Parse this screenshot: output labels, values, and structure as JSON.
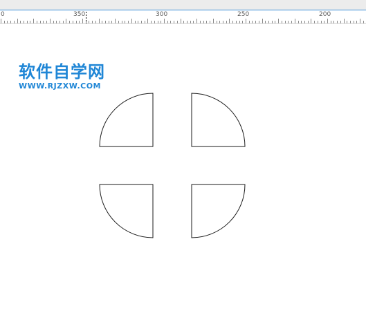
{
  "window": {
    "accent_color": "#3c8fd6"
  },
  "ruler": {
    "labels": [
      "0",
      "350",
      "300",
      "250",
      "200"
    ]
  },
  "watermark": {
    "title": "软件自学网",
    "url": "WWW.RJZXW.COM",
    "color": "#1f86d6"
  },
  "canvas": {
    "background": "#ffffff",
    "shapes": [
      {
        "name": "quarter-circle-top-left"
      },
      {
        "name": "quarter-circle-top-right"
      },
      {
        "name": "quarter-circle-bottom-left"
      },
      {
        "name": "quarter-circle-bottom-right"
      }
    ]
  }
}
